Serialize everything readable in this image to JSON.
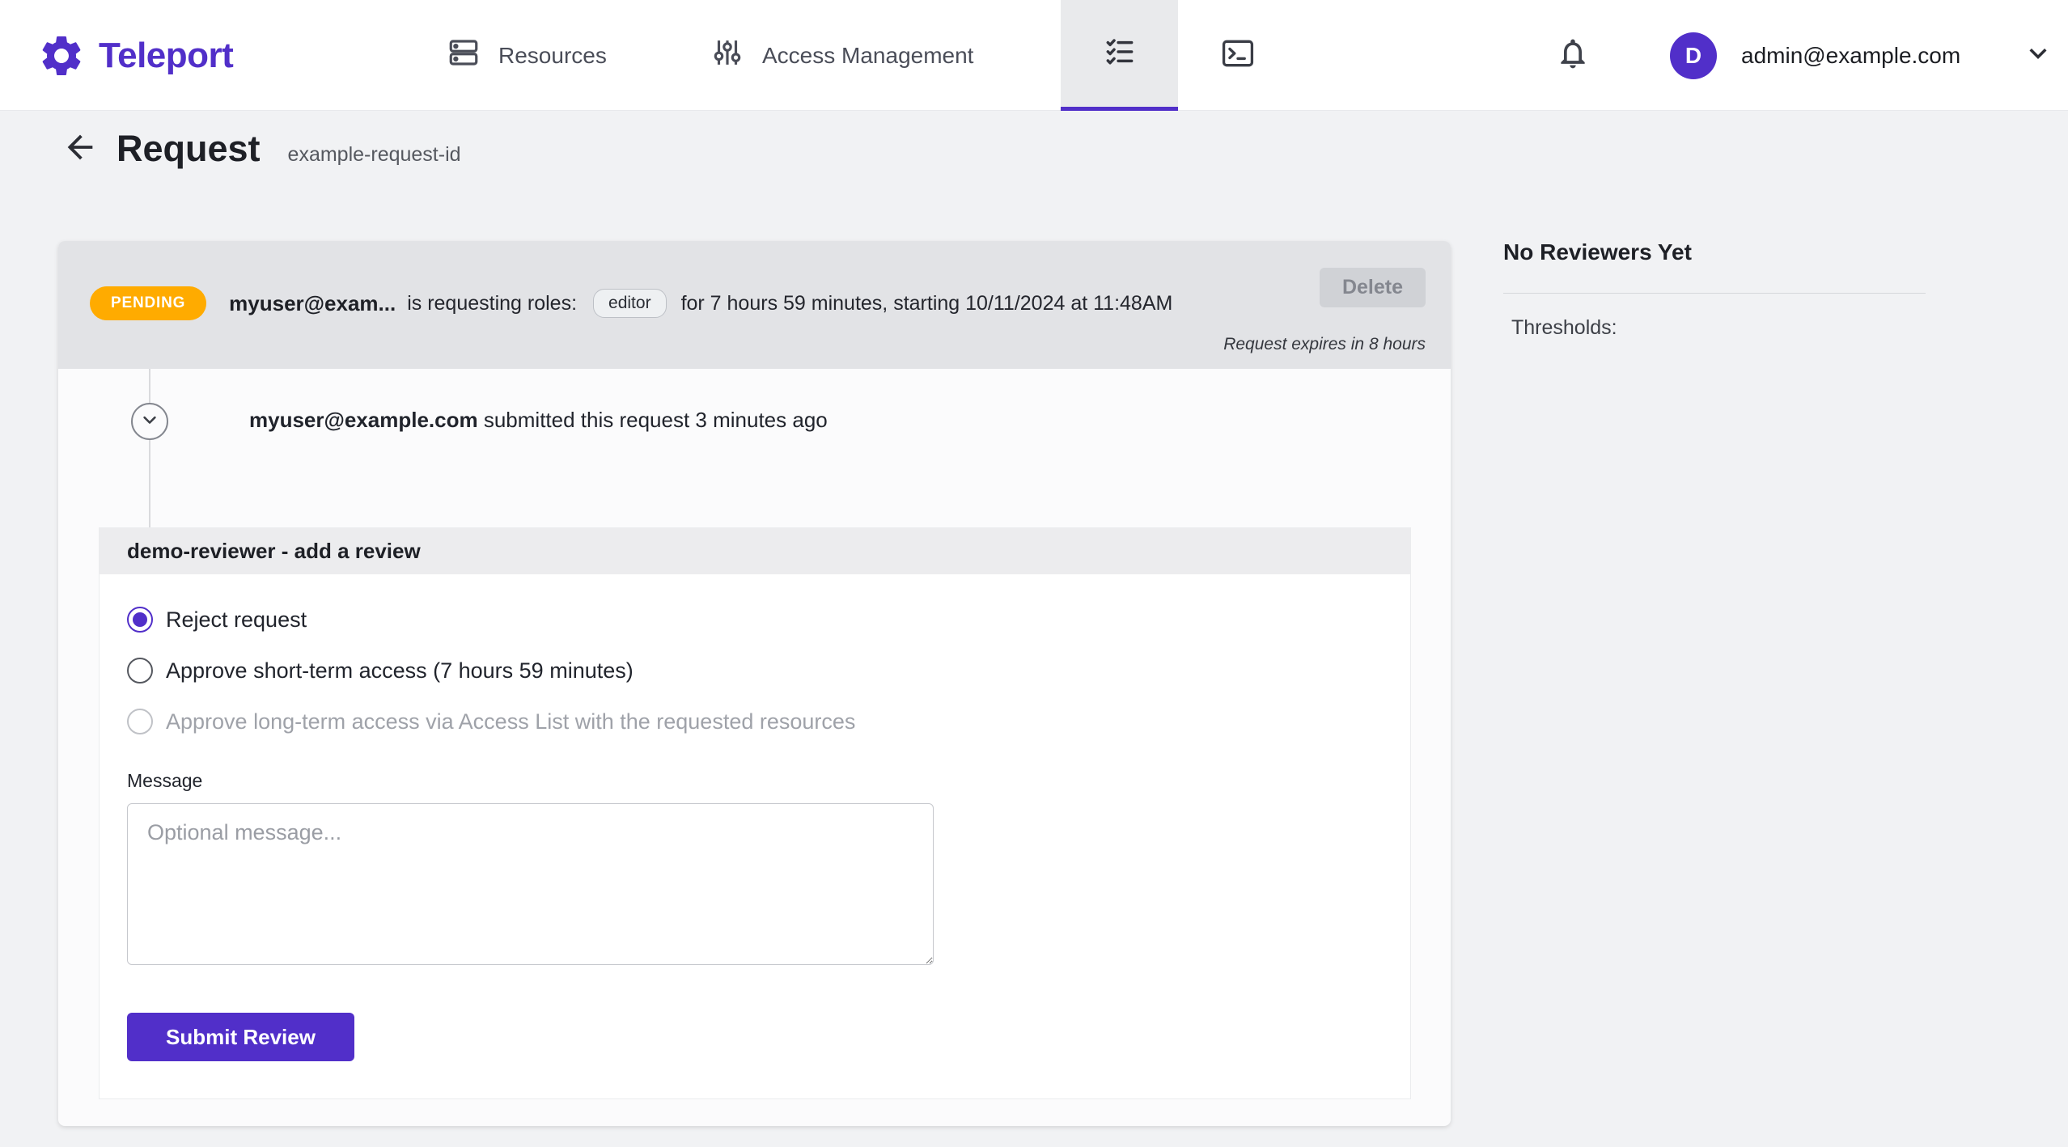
{
  "colors": {
    "brand": "#512FC9",
    "pending_badge": "#FFAB00"
  },
  "nav": {
    "brand": "Teleport",
    "resources_label": "Resources",
    "access_management_label": "Access Management",
    "user_email": "admin@example.com",
    "avatar_initial": "D"
  },
  "page": {
    "title": "Request",
    "request_id": "example-request-id"
  },
  "request": {
    "status": "PENDING",
    "requester": "myuser@exam...",
    "requesting_text": "is requesting roles:",
    "role": "editor",
    "schedule_text": "for 7 hours 59 minutes, starting 10/11/2024 at 11:48AM",
    "delete_label": "Delete",
    "expires_note": "Request expires in 8 hours",
    "event_user": "myuser@example.com",
    "event_text": " submitted this request 3 minutes ago"
  },
  "review": {
    "title": "demo-reviewer - add a review",
    "options": [
      {
        "label": "Reject request",
        "state": "selected"
      },
      {
        "label": "Approve short-term access (7 hours 59 minutes)",
        "state": "unselected"
      },
      {
        "label": "Approve long-term access via Access List with the requested resources",
        "state": "disabled"
      }
    ],
    "message_label": "Message",
    "message_placeholder": "Optional message...",
    "submit_label": "Submit Review"
  },
  "sidebar": {
    "title": "No Reviewers Yet",
    "thresholds_label": "Thresholds:"
  }
}
